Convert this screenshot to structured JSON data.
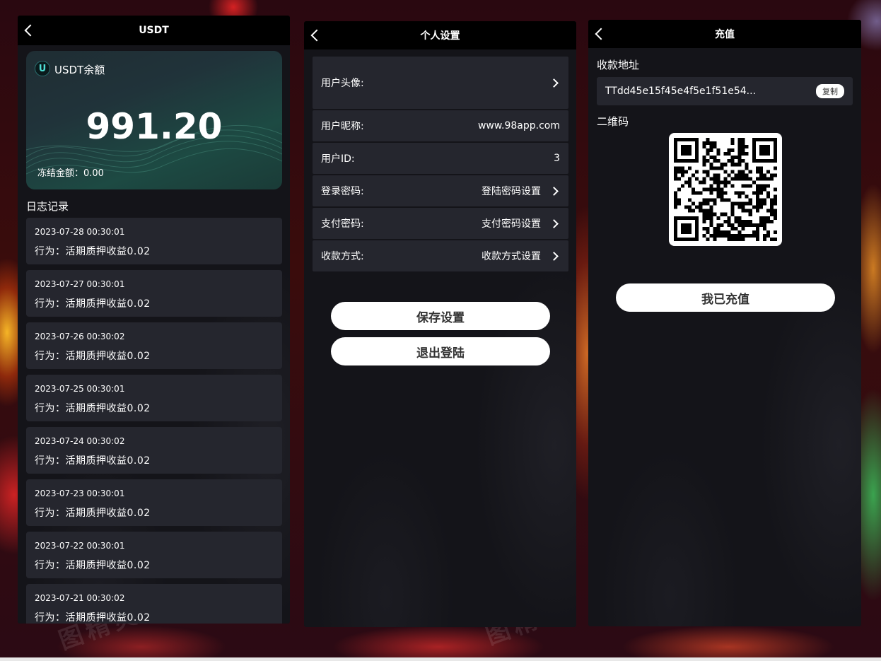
{
  "usdt_panel": {
    "title": "USDT",
    "balance_label": "USDT余额",
    "coin_icon_letter": "U",
    "balance": "991.20",
    "frozen": "冻结金额：0.00",
    "log_title": "日志记录",
    "logs": [
      {
        "time": "2023-07-28 00:30:01",
        "action": "行为：活期质押收益0.02"
      },
      {
        "time": "2023-07-27 00:30:01",
        "action": "行为：活期质押收益0.02"
      },
      {
        "time": "2023-07-26 00:30:02",
        "action": "行为：活期质押收益0.02"
      },
      {
        "time": "2023-07-25 00:30:01",
        "action": "行为：活期质押收益0.02"
      },
      {
        "time": "2023-07-24 00:30:02",
        "action": "行为：活期质押收益0.02"
      },
      {
        "time": "2023-07-23 00:30:01",
        "action": "行为：活期质押收益0.02"
      },
      {
        "time": "2023-07-22 00:30:01",
        "action": "行为：活期质押收益0.02"
      },
      {
        "time": "2023-07-21 00:30:02",
        "action": "行为：活期质押收益0.02"
      }
    ]
  },
  "settings_panel": {
    "title": "个人设置",
    "rows": [
      {
        "label": "用户头像:",
        "value": ""
      },
      {
        "label": "用户昵称:",
        "value": "www.98app.com"
      },
      {
        "label": "用户ID:",
        "value": "3"
      },
      {
        "label": "登录密码:",
        "value": "登陆密码设置"
      },
      {
        "label": "支付密码:",
        "value": "支付密码设置"
      },
      {
        "label": "收款方式:",
        "value": "收款方式设置"
      }
    ],
    "save_label": "保存设置",
    "logout_label": "退出登陆"
  },
  "recharge_panel": {
    "title": "充值",
    "address_label": "收款地址",
    "address": "TTdd45e15f45e4f5e1f51e54...",
    "copy_label": "复制",
    "qr_label": "二维码",
    "confirm_label": "我已充值"
  },
  "colors": {
    "panel_bg": "#141419",
    "header_bg": "#000000",
    "row_bg": "#25262e",
    "button_bg": "#ffffff",
    "accent_teal": "#4ee0d6"
  },
  "icons": [
    "back-arrow-icon",
    "usdt-coin-icon",
    "chevron-right-icon",
    "qr-code-icon"
  ]
}
